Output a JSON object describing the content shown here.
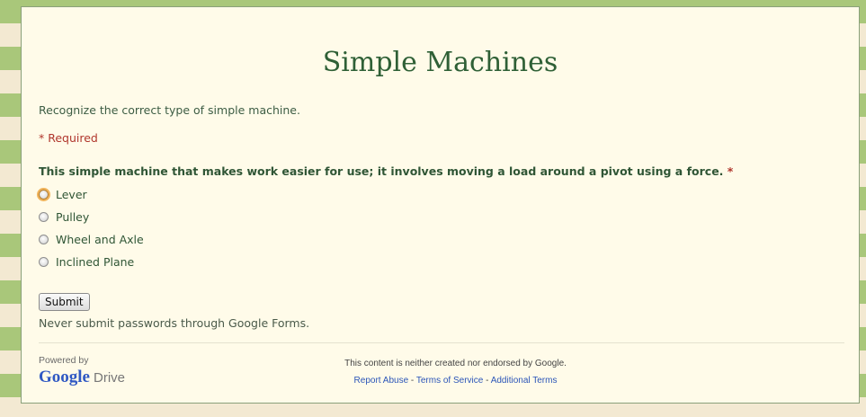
{
  "form": {
    "title": "Simple Machines",
    "description": "Recognize the correct type of simple machine.",
    "required_note": "* Required",
    "question": {
      "text": "This simple machine that makes work easier for use; it involves moving a load around a pivot using a force.",
      "required_mark": "*",
      "options": [
        "Lever",
        "Pulley",
        "Wheel and Axle",
        "Inclined Plane"
      ]
    },
    "submit_label": "Submit",
    "password_warning": "Never submit passwords through Google Forms."
  },
  "footer": {
    "powered_by": "Powered by",
    "logo_google": "Google",
    "logo_drive": "Drive",
    "disclaimer": "This content is neither created nor endorsed by Google.",
    "links": {
      "report_abuse": "Report Abuse",
      "separator": "-",
      "terms": "Terms of Service",
      "additional_terms": "Additional Terms"
    }
  },
  "colors": {
    "title": "#2f6036",
    "required": "#b0362c",
    "link": "#2b55b8",
    "background_pattern": "#a9c77a"
  }
}
